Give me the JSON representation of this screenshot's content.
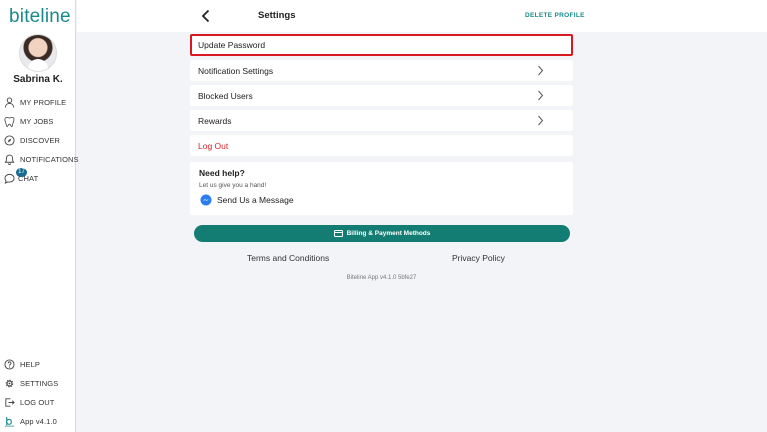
{
  "app": {
    "logo": "biteline",
    "version_label": "App v4.1.0"
  },
  "user": {
    "name": "Sabrina K."
  },
  "sidebar": {
    "items": [
      {
        "label": "MY PROFILE",
        "icon": "person-icon"
      },
      {
        "label": "MY JOBS",
        "icon": "tooth-icon"
      },
      {
        "label": "DISCOVER",
        "icon": "compass-icon"
      },
      {
        "label": "NOTIFICATIONS",
        "icon": "bell-icon"
      },
      {
        "label": "CHAT",
        "icon": "chat-bubble-icon",
        "badge": "17"
      }
    ],
    "bottom_items": [
      {
        "label": "HELP",
        "icon": "question-icon"
      },
      {
        "label": "SETTINGS",
        "icon": "gear-icon"
      },
      {
        "label": "LOG OUT",
        "icon": "logout-icon"
      }
    ]
  },
  "header": {
    "title": "Settings",
    "delete_label": "DELETE PROFILE"
  },
  "settings": {
    "rows": [
      {
        "label": "Update Password",
        "highlighted": true
      },
      {
        "label": "Notification Settings"
      },
      {
        "label": "Blocked Users"
      },
      {
        "label": "Rewards"
      }
    ],
    "logout_label": "Log Out"
  },
  "help": {
    "title": "Need help?",
    "subtitle": "Let us give you a hand!",
    "message_label": "Send Us a Message"
  },
  "billing": {
    "label": "Billing & Payment Methods"
  },
  "footer": {
    "terms": "Terms and Conditions",
    "privacy": "Privacy Policy",
    "build": "Biteline App v4.1.0 5bfe27"
  },
  "colors": {
    "brand": "#1a8a8a",
    "button": "#137d74",
    "danger": "#d9262b",
    "highlight": "#d9191f"
  }
}
